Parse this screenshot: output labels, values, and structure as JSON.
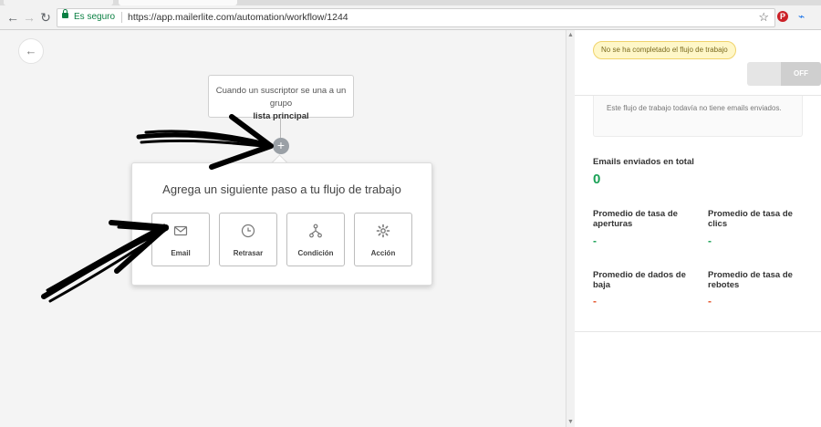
{
  "browser": {
    "secure_label": "Es seguro",
    "url": "https://app.mailerlite.com/automation/workflow/1244"
  },
  "workflow": {
    "trigger_text": "Cuando un suscriptor se una a un grupo",
    "trigger_group": "lista principal",
    "add_step_title": "Agrega un siguiente paso a tu flujo de trabajo",
    "options": [
      {
        "label": "Email",
        "icon": "envelope-icon"
      },
      {
        "label": "Retrasar",
        "icon": "clock-icon"
      },
      {
        "label": "Condición",
        "icon": "branch-icon"
      },
      {
        "label": "Acción",
        "icon": "gear-icon"
      }
    ]
  },
  "sidebar": {
    "status_badge": "No se ha completado el flujo de trabajo",
    "toggle_label": "OFF",
    "info_text": "Este flujo de trabajo todavía no tiene emails enviados.",
    "emails_sent_label": "Emails enviados en total",
    "emails_sent_value": "0",
    "stats": [
      {
        "label": "Promedio de tasa de aperturas",
        "value": "-",
        "color": "#1aa156"
      },
      {
        "label": "Promedio de tasa de clics",
        "value": "-",
        "color": "#1aa156"
      },
      {
        "label": "Promedio de dados de baja",
        "value": "-",
        "color": "#e4572e"
      },
      {
        "label": "Promedio de tasa de rebotes",
        "value": "-",
        "color": "#e4572e"
      }
    ]
  },
  "colors": {
    "accent_green": "#1aa156",
    "accent_red": "#e4572e",
    "warning_bg": "#fff7c8"
  }
}
